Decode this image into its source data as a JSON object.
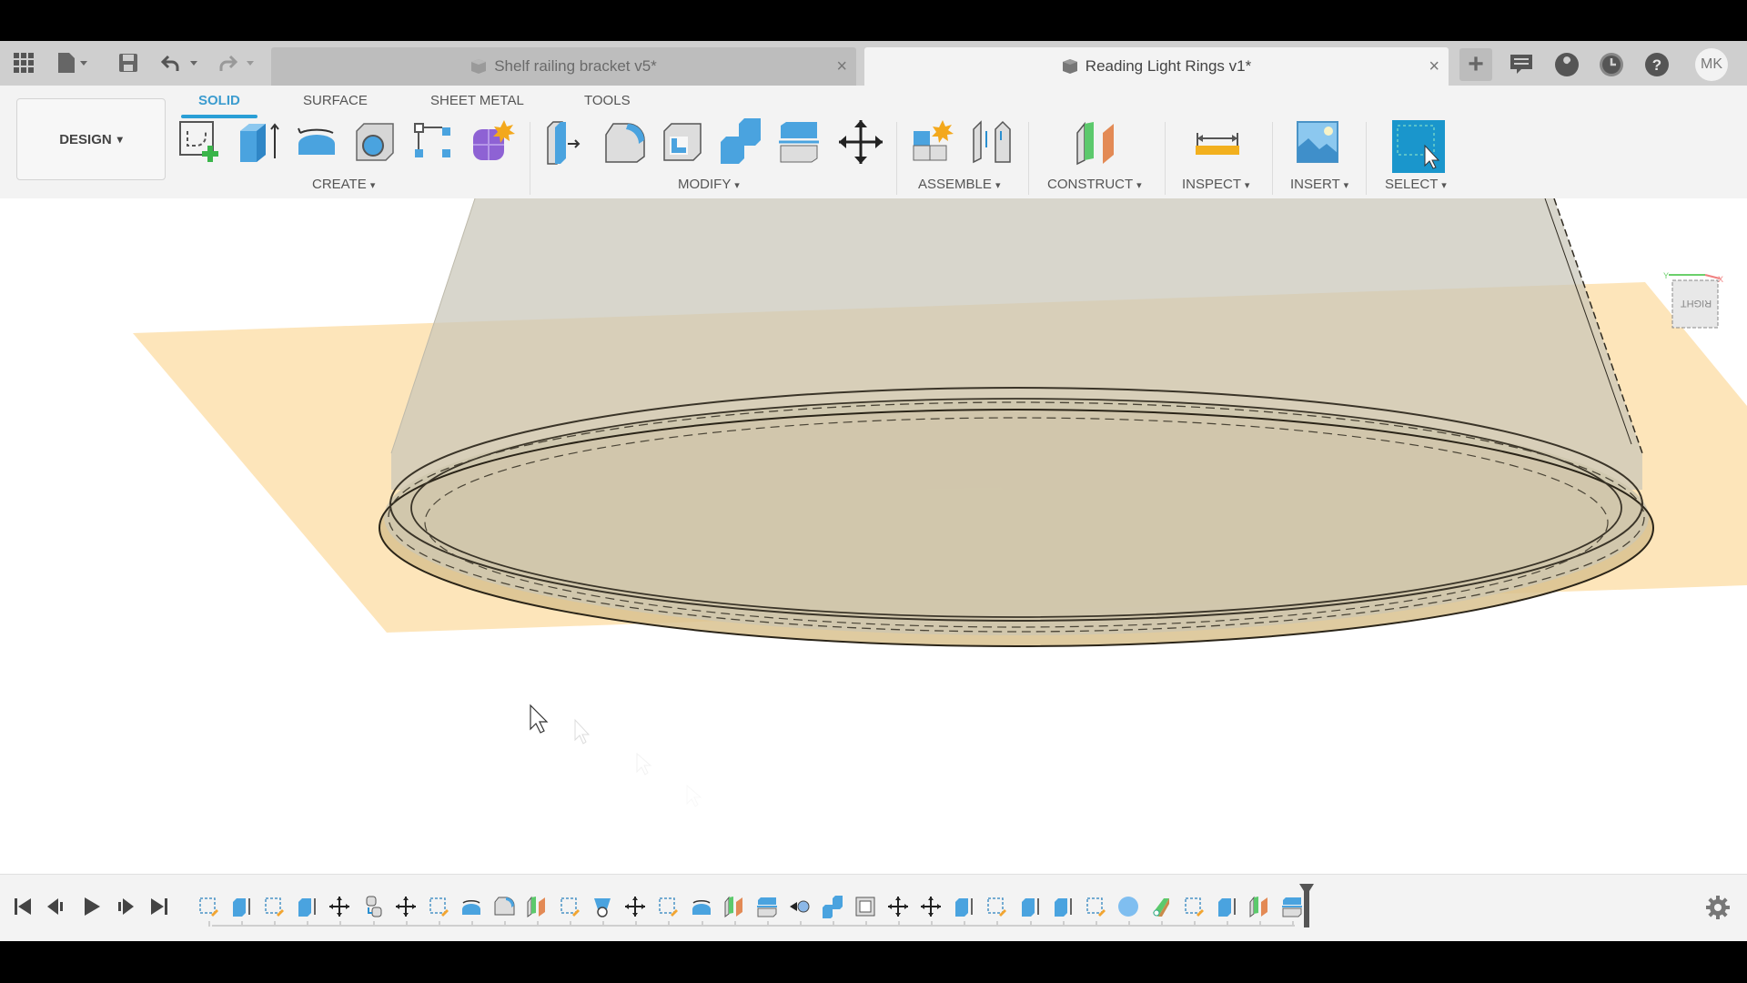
{
  "app": {
    "tabs": [
      {
        "label": "Shelf railing bracket v5*",
        "active": false,
        "close": "×"
      },
      {
        "label": "Reading Light Rings v1*",
        "active": true,
        "close": "×"
      }
    ],
    "new_tab_label": "+",
    "user_initials": "MK",
    "header_icons": [
      "grid-apps-icon",
      "file-icon",
      "save-icon",
      "undo-icon",
      "redo-icon",
      "comments-icon",
      "extensions-icon",
      "job-status-icon",
      "help-icon"
    ]
  },
  "toolbar": {
    "workspace_label": "DESIGN",
    "workspace_tabs": [
      "SOLID",
      "SURFACE",
      "SHEET METAL",
      "TOOLS"
    ],
    "active_workspace_tab": "SOLID",
    "groups": {
      "create": "CREATE",
      "modify": "MODIFY",
      "assemble": "ASSEMBLE",
      "construct": "CONSTRUCT",
      "inspect": "INSPECT",
      "insert": "INSERT",
      "select": "SELECT"
    },
    "caret": "▾"
  },
  "viewport": {
    "viewcube_face": "RIGHT",
    "axis_labels": {
      "y": "Y",
      "x": "X"
    }
  },
  "timeline": {
    "controls": [
      "first",
      "previous",
      "play",
      "next",
      "last"
    ],
    "feature_count": 34
  },
  "colors": {
    "accent": "#2a9fd6",
    "plane": "#fde3b4",
    "body": "#c8c5b6",
    "select_tool": "#1a96cc"
  }
}
